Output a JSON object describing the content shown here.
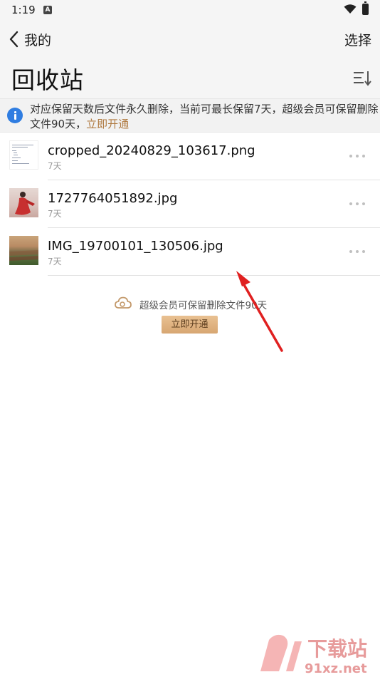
{
  "status_bar": {
    "time": "1:19",
    "notification_badge": "A"
  },
  "header": {
    "back_label": "我的",
    "select_label": "选择",
    "title": "回收站",
    "sort_icon": "sort-list-icon"
  },
  "banner": {
    "text": "对应保留天数后文件永久删除，当前可最长保留7天，超级会员可保留删除文件90天，",
    "link": "立即开通",
    "icon": "info-icon"
  },
  "files": [
    {
      "name": "cropped_20240829_103617.png",
      "days": "7天",
      "thumb": "document-thumbnail"
    },
    {
      "name": "1727764051892.jpg",
      "days": "7天",
      "thumb": "person-thumbnail"
    },
    {
      "name": "IMG_19700101_130506.jpg",
      "days": "7天",
      "thumb": "landscape-thumbnail"
    }
  ],
  "promo": {
    "text": "超级会员可保留删除文件90天",
    "button": "立即开通",
    "icon": "cloud-icon"
  },
  "watermark": {
    "logo_text": "下载站",
    "site": "91xz.net"
  },
  "colors": {
    "accent_gold": "#b07a40",
    "info_blue": "#2f7de1",
    "arrow_red": "#e02020",
    "header_bg": "#f5f5f5"
  }
}
